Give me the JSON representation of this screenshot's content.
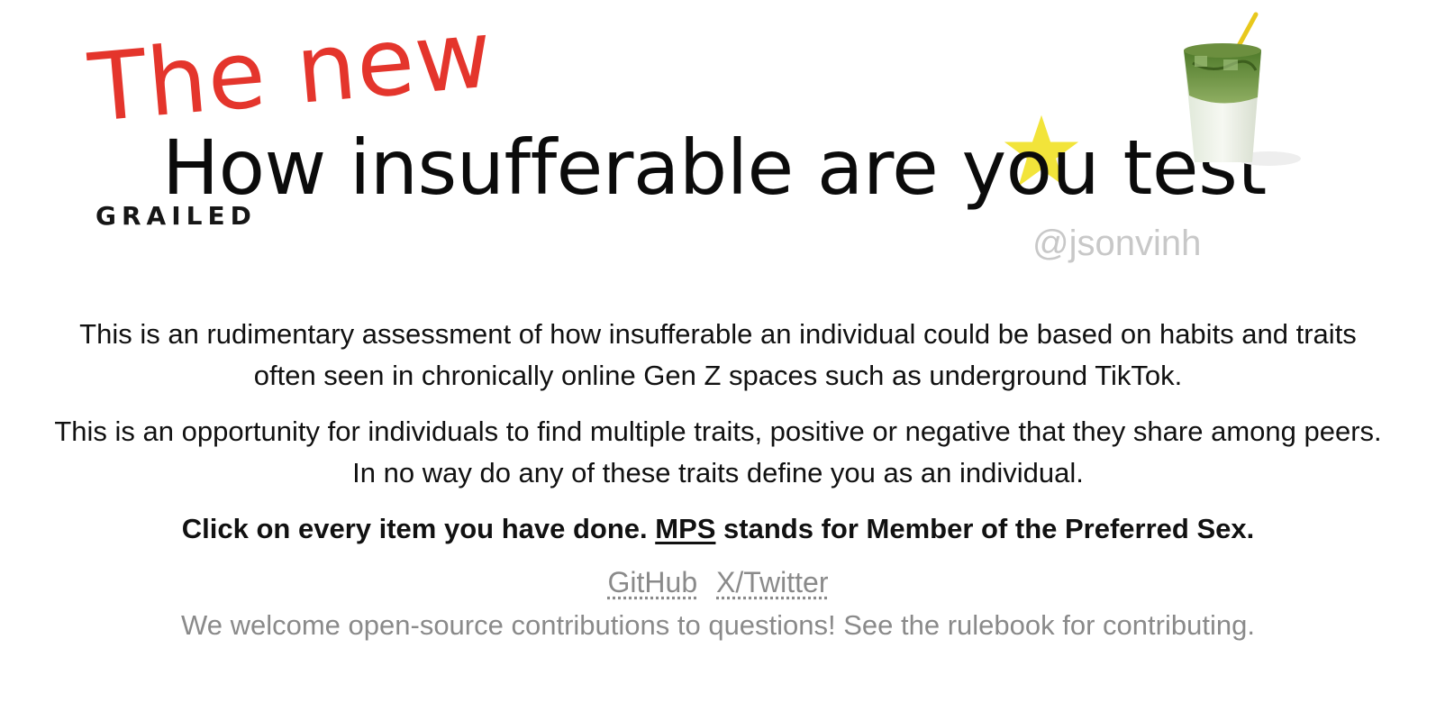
{
  "banner": {
    "kicker": "The new",
    "headline": "How insufferable are you test",
    "brand": "GRAILED",
    "handle": "@jsonvinh",
    "icons": [
      "star-icon",
      "matcha-drink-icon"
    ],
    "colors": {
      "kicker": "#e4352c",
      "star": "#f2e43a",
      "handle": "#c8c8c8"
    }
  },
  "intro": {
    "paragraph_1": "This is an rudimentary assessment of how insufferable an individual could be based on habits and traits often seen in chronically online Gen Z spaces such as underground TikTok.",
    "paragraph_2": "This is an opportunity for individuals to find multiple traits, positive or negative that they share among peers. In no way do any of these traits define you as an individual.",
    "instructions_before": "Click on every item you have done. ",
    "instructions_abbr": "MPS",
    "instructions_after": " stands for Member of the Preferred Sex."
  },
  "links": {
    "github": "GitHub",
    "twitter": "X/Twitter"
  },
  "contrib": "We welcome open-source contributions to questions! See the rulebook for contributing."
}
